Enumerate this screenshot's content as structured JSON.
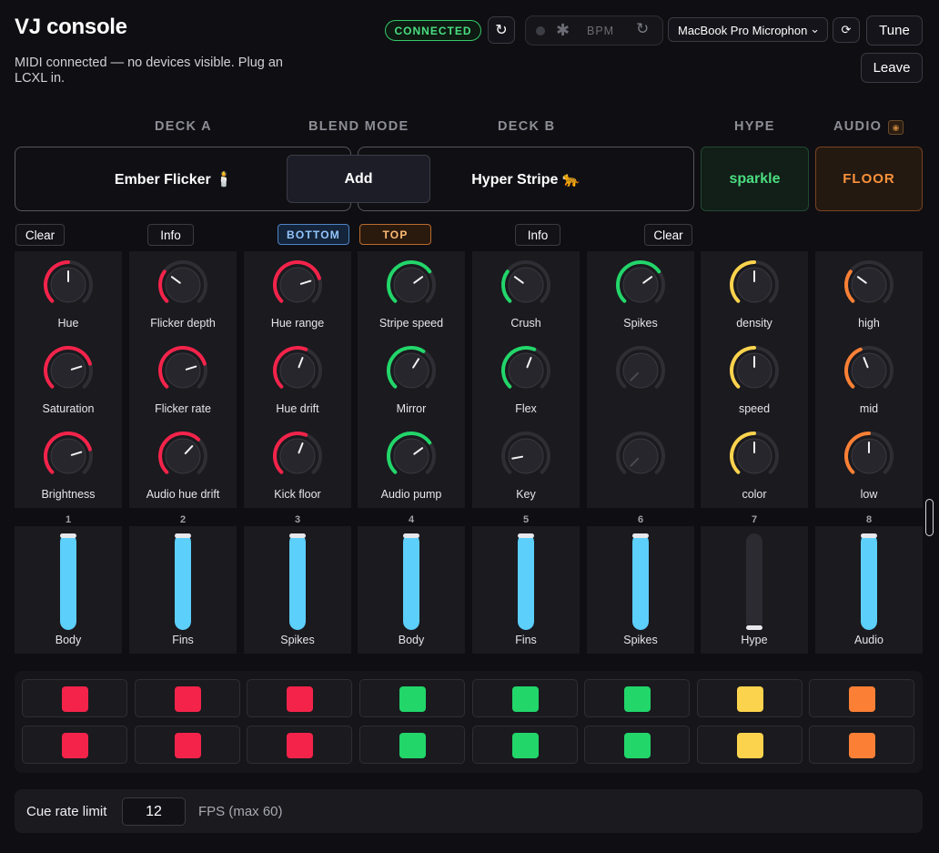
{
  "header": {
    "title": "VJ console",
    "status_message": "MIDI connected — no devices visible. Plug an LCXL in.",
    "connection_badge": "CONNECTED",
    "bpm_label": "BPM",
    "mic_select": "MacBook Pro Microphone",
    "tune_label": "Tune",
    "leave_label": "Leave"
  },
  "section_headers": {
    "deck_a": "DECK A",
    "blend_mode": "BLEND MODE",
    "deck_b": "DECK B",
    "hype": "HYPE",
    "audio": "AUDIO"
  },
  "decks": {
    "deck_a": "Ember Flicker 🕯️",
    "blend": "Add",
    "deck_b": "Hyper Stripe 🐆",
    "hype": "sparkle",
    "audio": "FLOOR"
  },
  "tags": {
    "clear_left": "Clear",
    "info_left": "Info",
    "bottom": "BOTTOM",
    "top": "TOP",
    "info_right": "Info",
    "clear_right": "Clear"
  },
  "colors": {
    "red": "#f4234a",
    "green": "#22d66a",
    "yellow": "#fcd34d",
    "orange": "#fb8035",
    "fader_blue": "#5ccffb",
    "accent_green": "#4ade80"
  },
  "knob_rows": [
    [
      {
        "label": "Hue",
        "value": 0.5,
        "color": "red"
      },
      {
        "label": "Flicker depth",
        "value": 0.3,
        "color": "red"
      },
      {
        "label": "Hue range",
        "value": 0.77,
        "color": "red"
      },
      {
        "label": "Stripe speed",
        "value": 0.7,
        "color": "green"
      },
      {
        "label": "Crush",
        "value": 0.3,
        "color": "green"
      },
      {
        "label": "Spikes",
        "value": 0.7,
        "color": "green"
      },
      {
        "label": "density",
        "value": 0.5,
        "color": "yellow"
      },
      {
        "label": "high",
        "value": 0.3,
        "color": "orange"
      }
    ],
    [
      {
        "label": "Saturation",
        "value": 0.77,
        "color": "red"
      },
      {
        "label": "Flicker rate",
        "value": 0.77,
        "color": "red"
      },
      {
        "label": "Hue drift",
        "value": 0.58,
        "color": "red"
      },
      {
        "label": "Mirror",
        "value": 0.62,
        "color": "green"
      },
      {
        "label": "Flex",
        "value": 0.58,
        "color": "green"
      },
      {
        "label": "",
        "value": 0.0,
        "color": "none"
      },
      {
        "label": "speed",
        "value": 0.5,
        "color": "yellow"
      },
      {
        "label": "mid",
        "value": 0.42,
        "color": "orange"
      }
    ],
    [
      {
        "label": "Brightness",
        "value": 0.77,
        "color": "red"
      },
      {
        "label": "Audio hue drift",
        "value": 0.66,
        "color": "red"
      },
      {
        "label": "Kick floor",
        "value": 0.58,
        "color": "red"
      },
      {
        "label": "Audio pump",
        "value": 0.7,
        "color": "green"
      },
      {
        "label": "Key",
        "value": 0.13,
        "color": "none"
      },
      {
        "label": "",
        "value": 0.0,
        "color": "none"
      },
      {
        "label": "color",
        "value": 0.5,
        "color": "yellow"
      },
      {
        "label": "low",
        "value": 0.5,
        "color": "orange"
      }
    ]
  ],
  "faders": [
    {
      "number": "1",
      "label": "Body",
      "value": 1.0
    },
    {
      "number": "2",
      "label": "Fins",
      "value": 1.0
    },
    {
      "number": "3",
      "label": "Spikes",
      "value": 1.0
    },
    {
      "number": "4",
      "label": "Body",
      "value": 1.0
    },
    {
      "number": "5",
      "label": "Fins",
      "value": 1.0
    },
    {
      "number": "6",
      "label": "Spikes",
      "value": 1.0
    },
    {
      "number": "7",
      "label": "Hype",
      "value": 0.0
    },
    {
      "number": "8",
      "label": "Audio",
      "value": 1.0
    }
  ],
  "pad_colors": [
    "red",
    "red",
    "red",
    "green",
    "green",
    "green",
    "yellow",
    "orange"
  ],
  "cue": {
    "label": "Cue rate limit",
    "value": "12",
    "unit": "FPS (max 60)"
  }
}
